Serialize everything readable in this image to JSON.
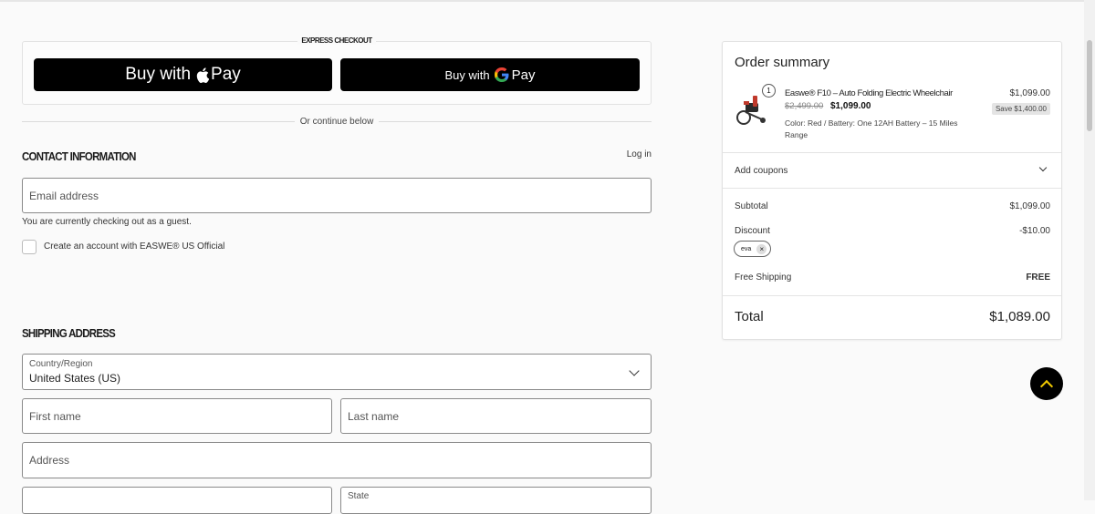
{
  "express": {
    "title": "Express checkout",
    "apple_pay": {
      "buy_with": "Buy with",
      "glyph": "",
      "pay": "Pay"
    },
    "google_pay": {
      "buy_with": "Buy with",
      "pay": "Pay",
      "g_colors": [
        "#4285F4",
        "#EA4335",
        "#FBBC05",
        "#34A853"
      ]
    },
    "divider": "Or continue below"
  },
  "contact": {
    "title": "Contact information",
    "login": "Log in",
    "email_placeholder": "Email address",
    "guest_note": "You are currently checking out as a guest.",
    "create_account": "Create an account with EASWE® US Official"
  },
  "shipping": {
    "title": "Shipping address",
    "country_label": "Country/Region",
    "country_value": "United States (US)",
    "first_name": "First name",
    "last_name": "Last name",
    "address": "Address",
    "state_label": "State"
  },
  "summary": {
    "title": "Order summary",
    "item": {
      "qty": "1",
      "name": "Easwe® F10 – Auto Folding Electric Wheelchair",
      "old_price": "$2,499.00",
      "new_price": "$1,099.00",
      "variant": "Color: Red / Battery: One 12AH Battery – 15 Miles Range",
      "line_price": "$1,099.00",
      "save": "Save $1,400.00"
    },
    "coupons_label": "Add coupons",
    "subtotal_label": "Subtotal",
    "subtotal_value": "$1,099.00",
    "discount_label": "Discount",
    "discount_value": "-$10.00",
    "coupon_code": "eva",
    "shipping_label": "Free Shipping",
    "shipping_value": "FREE",
    "total_label": "Total",
    "total_value": "$1,089.00"
  },
  "colors": {
    "accent": "#000000",
    "scroll_top_arrow": "#f0c800"
  }
}
